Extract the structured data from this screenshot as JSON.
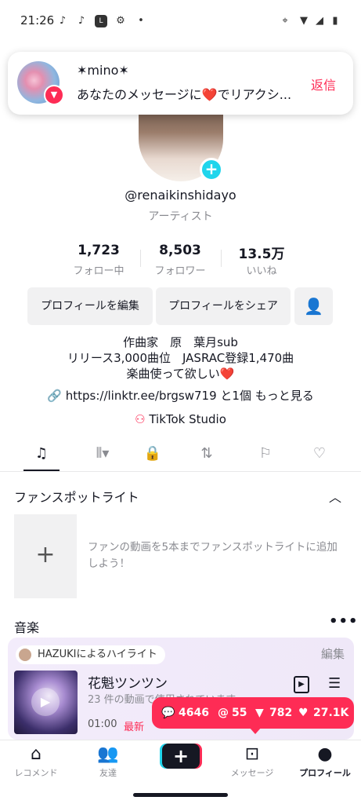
{
  "status": {
    "time": "21:26"
  },
  "notification": {
    "name": "✶mino✶",
    "message": "あなたのメッセージに❤️でリアクシ...",
    "reply": "返信"
  },
  "profile": {
    "handle": "@renaikinshidayo",
    "role": "アーティスト"
  },
  "stats": [
    {
      "num": "1,723",
      "label": "フォロー中"
    },
    {
      "num": "8,503",
      "label": "フォロワー"
    },
    {
      "num": "13.5万",
      "label": "いいね"
    }
  ],
  "buttons": {
    "edit": "プロフィールを編集",
    "share": "プロフィールをシェア"
  },
  "bio": [
    "作曲家　原　葉月sub",
    "リリース3,000曲位　JASRAC登録1,470曲",
    "楽曲使って欲しい❤️"
  ],
  "link": {
    "url": "https://linktr.ee/brgsw719",
    "more": "と1個 もっと見る"
  },
  "studio": "TikTok Studio",
  "fans": {
    "title": "ファンスポットライト",
    "text": "ファンの動画を5本までファンスポットライトに追加しよう！"
  },
  "music": {
    "title": "音楽",
    "highlight": "HAZUKIによるハイライト",
    "edit": "編集",
    "song": "花魁ツンツン",
    "sub": "23 件の動画で使用されています",
    "duration": "01:00",
    "new": "最新"
  },
  "bubble": {
    "comments": "4646",
    "mentions": "55",
    "shares": "782",
    "likes": "27.1K"
  },
  "nav": [
    {
      "label": "レコメンド"
    },
    {
      "label": "友達"
    },
    {
      "label": "メッセージ"
    },
    {
      "label": "プロフィール"
    }
  ],
  "colors": {
    "accent": "#fe2c55",
    "cyan": "#20d5ec",
    "text": "#161823",
    "muted": "#8a8b91"
  }
}
